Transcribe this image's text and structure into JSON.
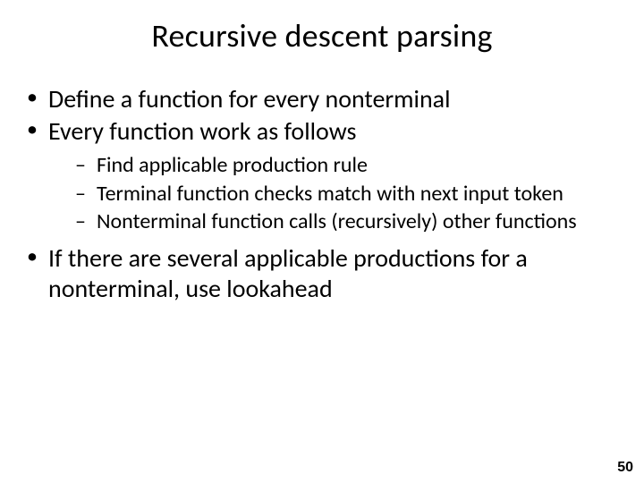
{
  "title": "Recursive descent parsing",
  "bullets": {
    "b0": "Define a function for every nonterminal",
    "b1": "Every function work as follows",
    "b1_sub": {
      "s0": "Find applicable production rule",
      "s1": "Terminal function checks match with next input token",
      "s2": "Nonterminal function calls (recursively) other functions"
    },
    "b2": "If there are several applicable productions for a nonterminal, use lookahead"
  },
  "page_number": "50"
}
